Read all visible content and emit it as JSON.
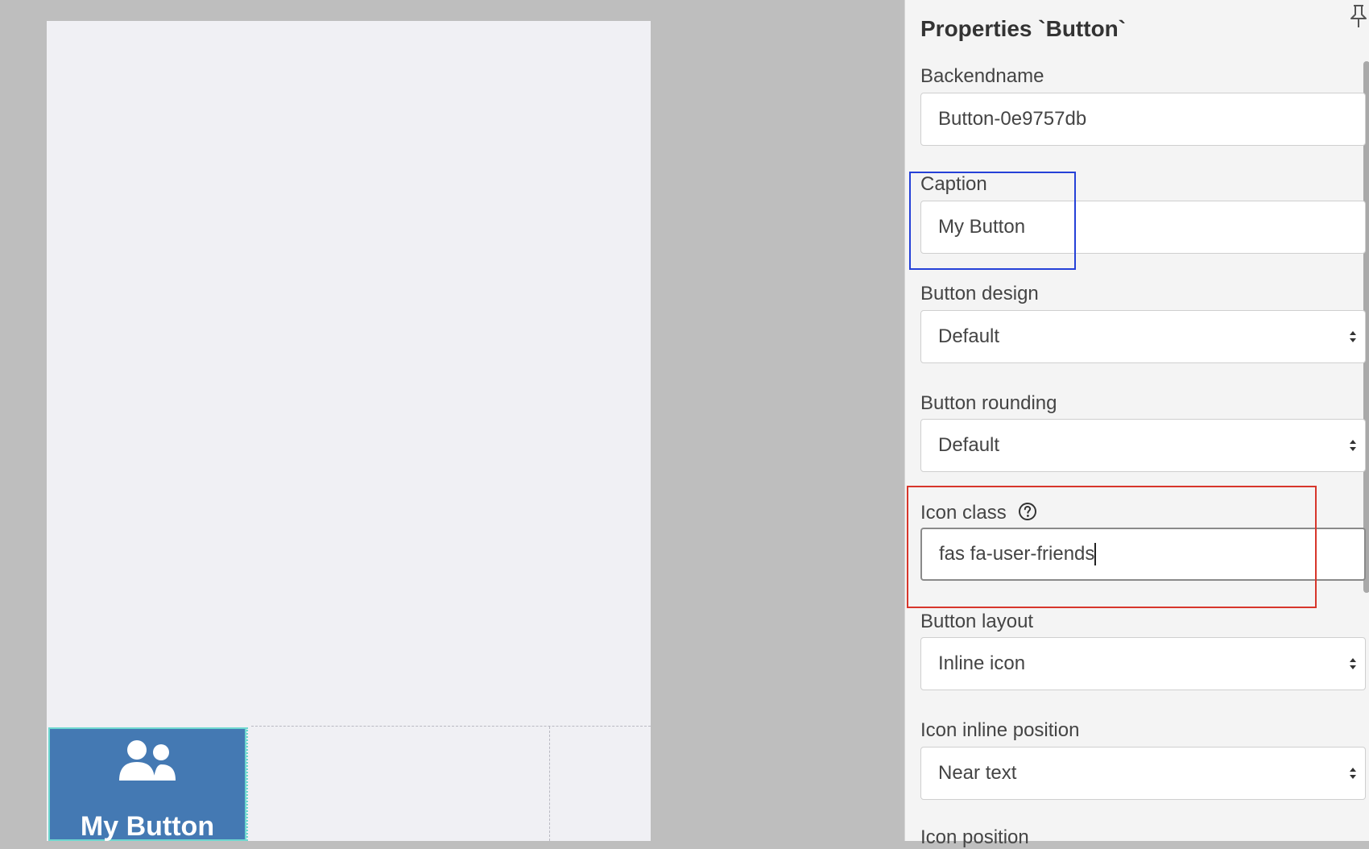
{
  "canvas": {
    "preview_button": {
      "label": "My Button",
      "icon": "user-friends-icon"
    }
  },
  "panel": {
    "title": "Properties `Button`",
    "pin_icon": "pin-icon",
    "fields": {
      "backendname": {
        "label": "Backendname",
        "value": "Button-0e9757db"
      },
      "caption": {
        "label": "Caption",
        "value": "My Button"
      },
      "button_design": {
        "label": "Button design",
        "value": "Default"
      },
      "button_rounding": {
        "label": "Button rounding",
        "value": "Default"
      },
      "icon_class": {
        "label": "Icon class",
        "value": "fas fa-user-friends",
        "help_icon": "question-circle-icon"
      },
      "button_layout": {
        "label": "Button layout",
        "value": "Inline icon"
      },
      "icon_inline_position": {
        "label": "Icon inline position",
        "value": "Near text"
      },
      "icon_position": {
        "label": "Icon position"
      }
    },
    "highlight_colors": {
      "caption": "#2541d8",
      "icon_class": "#d7362b"
    }
  },
  "colors": {
    "background": "#bebebe",
    "canvas": "#f0f0f4",
    "button_fill": "#4479b3",
    "selection_outline": "#6fd8d0"
  }
}
